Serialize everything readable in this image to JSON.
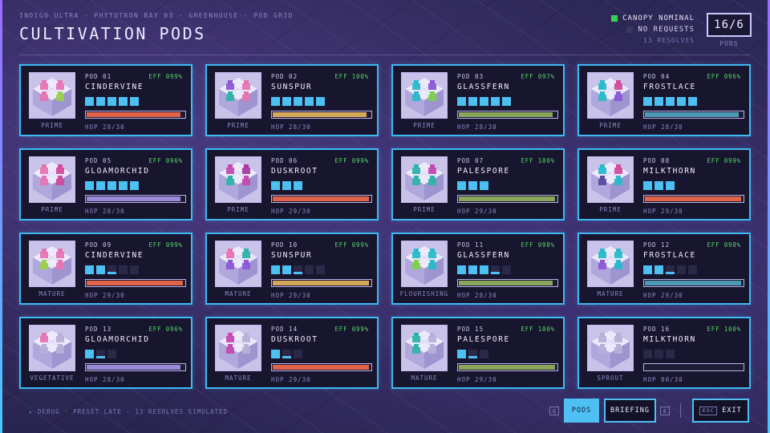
{
  "header": {
    "breadcrumb": "INDIGO ULTRA · PHYTOTRON BAY 03 · GREENHOUSE · POD GRID",
    "title": "CULTIVATION PODS"
  },
  "status": {
    "canopy": {
      "text": "CANOPY NOMINAL",
      "color": "#39d353"
    },
    "requests": {
      "text": "NO REQUESTS",
      "color": "#3a3860"
    },
    "resolves": "13 RESOLVES",
    "counter": "16/6",
    "counter_label": "PODS"
  },
  "colors": {
    "frame": "#3fb9f2",
    "eff": "#52d768",
    "segment": "#4cc0f2",
    "background": "#2a2450"
  },
  "pods": [
    {
      "no": "POD 01",
      "name": "CINDERVINE",
      "eff": "EFF 099%",
      "stage": "PRIME",
      "hop": "HOP 28/30",
      "segments": [
        1,
        1,
        1,
        1,
        1
      ],
      "bar": 0.96,
      "bar_color": "#e0634a",
      "art": "cinder",
      "plants": [
        "#e774b2",
        "#e774b2",
        "#e774b2",
        "#9ad14b"
      ]
    },
    {
      "no": "POD 02",
      "name": "SUNSPUR",
      "eff": "EFF 100%",
      "stage": "PRIME",
      "hop": "HOP 28/30",
      "segments": [
        1,
        1,
        1,
        1,
        1
      ],
      "bar": 0.96,
      "bar_color": "#d7a85a",
      "art": "sun",
      "plants": [
        "#8c58d6",
        "#e774b2",
        "#2fb3a8",
        "#e774b2"
      ]
    },
    {
      "no": "POD 03",
      "name": "GLASSFERN",
      "eff": "EFF 097%",
      "stage": "PRIME",
      "hop": "HOP 28/30",
      "segments": [
        1,
        1,
        1,
        1,
        1
      ],
      "bar": 0.96,
      "bar_color": "#8aa65a",
      "art": "glass",
      "plants": [
        "#29b9c8",
        "#8c58d6",
        "#29b9c8",
        "#7cd14b"
      ]
    },
    {
      "no": "POD 04",
      "name": "FROSTLACE",
      "eff": "EFF 096%",
      "stage": "PRIME",
      "hop": "HOP 28/30",
      "segments": [
        1,
        1,
        1,
        1,
        1
      ],
      "bar": 0.96,
      "bar_color": "#4c9ab8",
      "art": "frost",
      "plants": [
        "#29b9c8",
        "#d14b9c",
        "#29b9c8",
        "#8c58d6"
      ]
    },
    {
      "no": "POD 05",
      "name": "GLOAMORCHID",
      "eff": "EFF 096%",
      "stage": "PRIME",
      "hop": "HOP 28/30",
      "segments": [
        1,
        1,
        1,
        1,
        1
      ],
      "bar": 0.96,
      "bar_color": "#9b8ad8",
      "art": "gloam",
      "plants": [
        "#e774b2",
        "#d14b9c",
        "#e774b2",
        "#d14b9c"
      ]
    },
    {
      "no": "POD 06",
      "name": "DUSKROOT",
      "eff": "EFF 099%",
      "stage": "PRIME",
      "hop": "HOP 29/30",
      "segments": [
        1,
        1,
        1
      ],
      "bar": 0.98,
      "bar_color": "#e0634a",
      "art": "dusk",
      "plants": [
        "#c24ab0",
        "#a63a9c",
        "#2fb3a8",
        "#c24ab0"
      ]
    },
    {
      "no": "POD 07",
      "name": "PALESPORE",
      "eff": "EFF 100%",
      "stage": "PRIME",
      "hop": "HOP 29/30",
      "segments": [
        1,
        1,
        1
      ],
      "bar": 0.98,
      "bar_color": "#8aa65a",
      "art": "pale",
      "plants": [
        "#2fb3a8",
        "#c24ab0",
        "#2fb3a8",
        "#2fb3a8"
      ]
    },
    {
      "no": "POD 08",
      "name": "MILKTHORN",
      "eff": "EFF 099%",
      "stage": "PRIME",
      "hop": "HOP 29/30",
      "segments": [
        1,
        1,
        1
      ],
      "bar": 0.98,
      "bar_color": "#e0634a",
      "art": "milk",
      "plants": [
        "#29b9c8",
        "#d14b9c",
        "#5b4aa0",
        "#29b9c8"
      ]
    },
    {
      "no": "POD 09",
      "name": "CINDERVINE",
      "eff": "EFF 099%",
      "stage": "MATURE",
      "hop": "HOP 29/30",
      "segments": [
        1,
        1,
        0.3,
        0,
        0
      ],
      "bar": 0.98,
      "bar_color": "#e0634a",
      "art": "cinder",
      "plants": [
        "#e774b2",
        "#e774b2",
        "#9ad14b",
        "#e774b2"
      ]
    },
    {
      "no": "POD 10",
      "name": "SUNSPUR",
      "eff": "EFF 099%",
      "stage": "MATURE",
      "hop": "HOP 29/30",
      "segments": [
        1,
        1,
        0.3,
        0,
        0
      ],
      "bar": 0.98,
      "bar_color": "#d7a85a",
      "art": "sun",
      "plants": [
        "#e774b2",
        "#2fb3a8",
        "#8c58d6",
        "#8c58d6"
      ]
    },
    {
      "no": "POD 11",
      "name": "GLASSFERN",
      "eff": "EFF 098%",
      "stage": "FLOURISHING",
      "hop": "HOP 28/30",
      "segments": [
        1,
        1,
        1,
        0.3,
        0
      ],
      "bar": 0.96,
      "bar_color": "#8aa65a",
      "art": "glass",
      "plants": [
        "#29b9c8",
        "#29b9c8",
        "#7cd14b",
        "#29b9c8"
      ]
    },
    {
      "no": "POD 12",
      "name": "FROSTLACE",
      "eff": "EFF 098%",
      "stage": "MATURE",
      "hop": "HOP 29/30",
      "segments": [
        1,
        1,
        0.3,
        0,
        0
      ],
      "bar": 0.98,
      "bar_color": "#4c9ab8",
      "art": "frost",
      "plants": [
        "#29b9c8",
        "#29b9c8",
        "#8c58d6",
        "#29b9c8"
      ]
    },
    {
      "no": "POD 13",
      "name": "GLOAMORCHID",
      "eff": "EFF 096%",
      "stage": "VEGETATIVE",
      "hop": "HOP 28/30",
      "segments": [
        1,
        0.3,
        0
      ],
      "bar": 0.96,
      "bar_color": "#9b8ad8",
      "art": "gloam",
      "plants": [
        "#e774b2",
        "#b8b0d8",
        "#b8b0d8",
        "#b8b0d8"
      ]
    },
    {
      "no": "POD 14",
      "name": "DUSKROOT",
      "eff": "EFF 099%",
      "stage": "MATURE",
      "hop": "HOP 29/30",
      "segments": [
        1,
        0.3,
        0
      ],
      "bar": 0.98,
      "bar_color": "#e0634a",
      "art": "dusk",
      "plants": [
        "#c24ab0",
        "#b8b0d8",
        "#c24ab0",
        "#b8b0d8"
      ]
    },
    {
      "no": "POD 15",
      "name": "PALESPORE",
      "eff": "EFF 100%",
      "stage": "MATURE",
      "hop": "HOP 29/30",
      "segments": [
        1,
        0.3,
        0
      ],
      "bar": 0.98,
      "bar_color": "#8aa65a",
      "art": "pale",
      "plants": [
        "#2fb3a8",
        "#b8b0d8",
        "#2fb3a8",
        "#b8b0d8"
      ]
    },
    {
      "no": "POD 16",
      "name": "MILKTHORN",
      "eff": "EFF 100%",
      "stage": "SPROUT",
      "hop": "HOP 00/30",
      "segments": [
        0,
        0,
        0
      ],
      "bar": 0,
      "bar_color": "#e0634a",
      "art": "milk",
      "plants": [
        "#b8b0d8",
        "#b8b0d8",
        "#b8b0d8",
        "#b8b0d8"
      ]
    }
  ],
  "footer": {
    "debug": "▸ DEBUG · PRESET LATE · 13 RESOLVES SIMULATED",
    "key_q": "Q",
    "pods": "PODS",
    "briefing": "BRIEFING",
    "key_e": "E",
    "key_esc": "ESC",
    "exit": "EXIT"
  }
}
